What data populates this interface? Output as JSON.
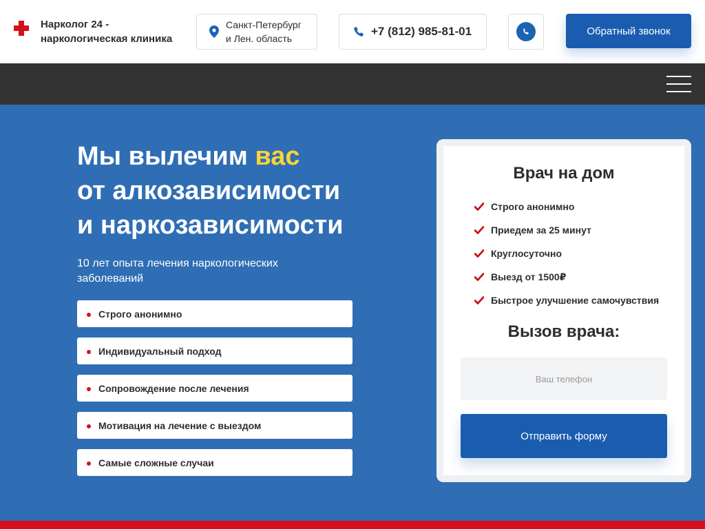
{
  "colors": {
    "brand_blue": "#1a5db0",
    "hero_blue": "#2f6eb4",
    "accent_red": "#d4111b",
    "highlight_yellow": "#ffd335",
    "nav_dark": "#333333"
  },
  "header": {
    "logo_icon": "red-cross-icon",
    "logo_line1": "Нарколог 24 -",
    "logo_line2": "наркологическая клиника",
    "location_icon": "map-pin-icon",
    "location_line1": "Санкт-Петербург",
    "location_line2": "и Лен. область",
    "phone_icon": "phone-icon",
    "phone": "+7 (812) 985-81-01",
    "whatsapp_icon": "whatsapp-icon",
    "callback_label": "Обратный звонок"
  },
  "nav": {
    "menu_icon": "hamburger-menu-icon"
  },
  "hero": {
    "title_line1_start": "Мы вылечим ",
    "title_highlight": "вас",
    "title_line2": "от алкозависимости",
    "title_line3": "и наркозависимости",
    "subtitle": "10 лет опыта лечения наркологических заболеваний",
    "features": [
      "Строго анонимно",
      "Индивидуальный подход",
      "Сопровождение после лечения",
      "Мотивация на лечение с выездом",
      "Самые сложные случаи"
    ]
  },
  "form": {
    "title": "Врач на дом",
    "checks": [
      "Строго анонимно",
      "Приедем за 25 минут",
      "Круглосуточно",
      "Выезд от 1500₽",
      "Быстрое улучшение самочувствия"
    ],
    "call_title": "Вызов врача:",
    "phone_placeholder": "Ваш телефон",
    "submit_label": "Отправить форму"
  }
}
